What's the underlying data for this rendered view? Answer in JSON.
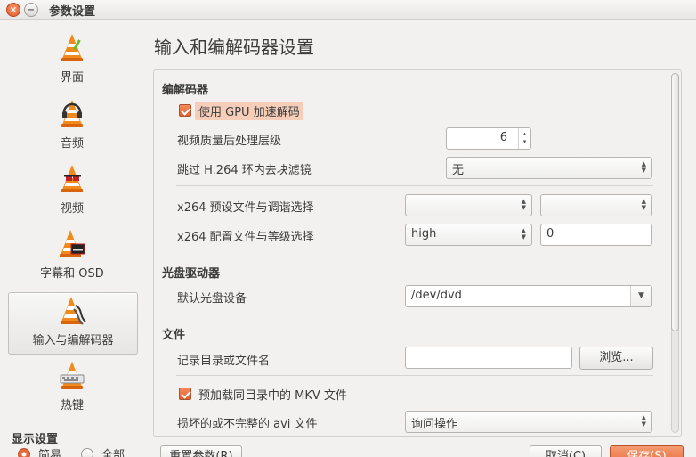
{
  "window": {
    "title": "参数设置",
    "close_glyph": "×",
    "minimize_glyph": "−"
  },
  "sidebar": {
    "items": [
      {
        "label": "界面",
        "icon": "cone-brush-icon"
      },
      {
        "label": "音频",
        "icon": "cone-headphones-icon"
      },
      {
        "label": "视频",
        "icon": "cone-glasses-icon"
      },
      {
        "label": "字幕和 OSD",
        "icon": "cone-subtitle-icon"
      },
      {
        "label": "输入与编解码器",
        "icon": "cone-cables-icon"
      },
      {
        "label": "热键",
        "icon": "cone-keyboard-icon"
      }
    ],
    "active_index": 4
  },
  "show_settings": {
    "title": "显示设置",
    "options": [
      "简易",
      "全部"
    ],
    "selected": "简易"
  },
  "main": {
    "title": "输入和编解码器设置",
    "codec": {
      "section": "编解码器",
      "gpu_decode": {
        "label": "使用 GPU 加速解码",
        "checked": true
      },
      "postproc": {
        "label": "视频质量后处理层级",
        "value": "6"
      },
      "skip_loop": {
        "label": "跳过 H.264 环内去块滤镜",
        "value": "无"
      },
      "x264_preset": {
        "label": "x264 预设文件与调谐选择",
        "value_a": "",
        "value_b": ""
      },
      "x264_profile": {
        "label": "x264 配置文件与等级选择",
        "value_profile": "high",
        "value_level": "0"
      }
    },
    "disc": {
      "section": "光盘驱动器",
      "device": {
        "label": "默认光盘设备",
        "value": "/dev/dvd"
      }
    },
    "files": {
      "section": "文件",
      "record": {
        "label": "记录目录或文件名",
        "value": "",
        "browse": "浏览..."
      },
      "preload_mkv": {
        "label": "预加载同目录中的 MKV 文件",
        "checked": true
      },
      "broken_avi": {
        "label": "损坏的或不完整的 avi 文件",
        "value": "询问操作"
      }
    }
  },
  "footer": {
    "reset": "重置参数(R)",
    "cancel": "取消(C)",
    "save": "保存(S)"
  },
  "colors": {
    "accent": "#e5683a",
    "cone_orange": "#f08a1c"
  }
}
